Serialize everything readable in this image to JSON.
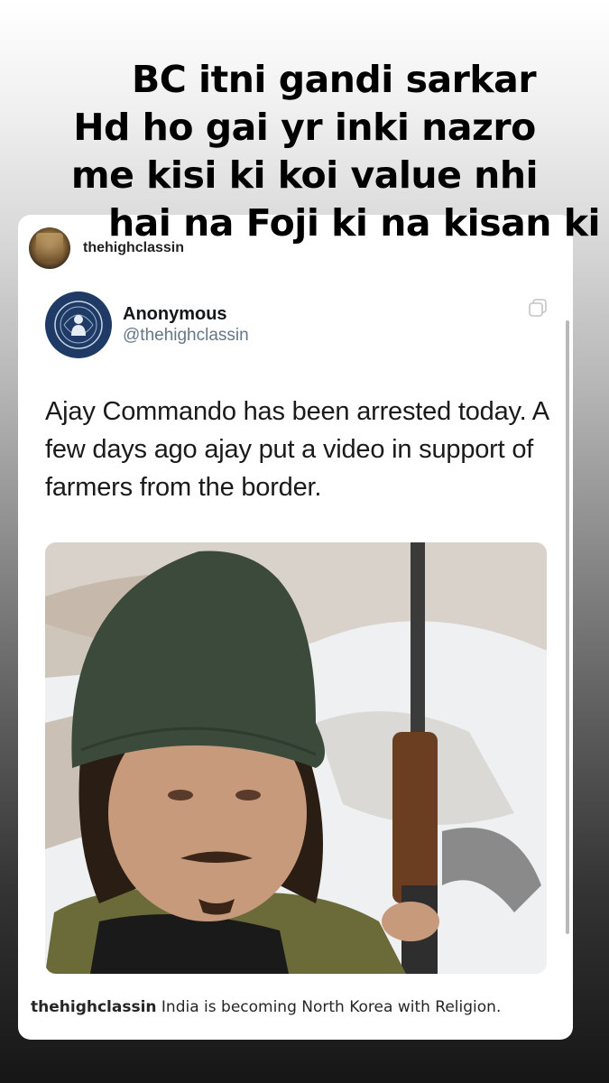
{
  "overlay": {
    "line1": "BC itni gandi sarkar",
    "line2": "Hd ho gai yr inki nazro",
    "line3": "me kisi ki koi value nhi",
    "line4": "hai na Foji ki na kisan ki"
  },
  "post": {
    "username": "thehighclassin",
    "tweet": {
      "name": "Anonymous",
      "handle": "@thehighclassin",
      "text": "Ajay Commando has been arrested today. A few days ago ajay put a video in support of farmers from the border."
    },
    "caption_user": "thehighclassin",
    "caption_text": "India is becoming North Korea with Religion."
  },
  "colors": {
    "tweet_avatar_bg": "#1f3a64",
    "handle_gray": "#657786"
  },
  "icons": [
    "copy-icon",
    "anonymous-logo-icon"
  ]
}
